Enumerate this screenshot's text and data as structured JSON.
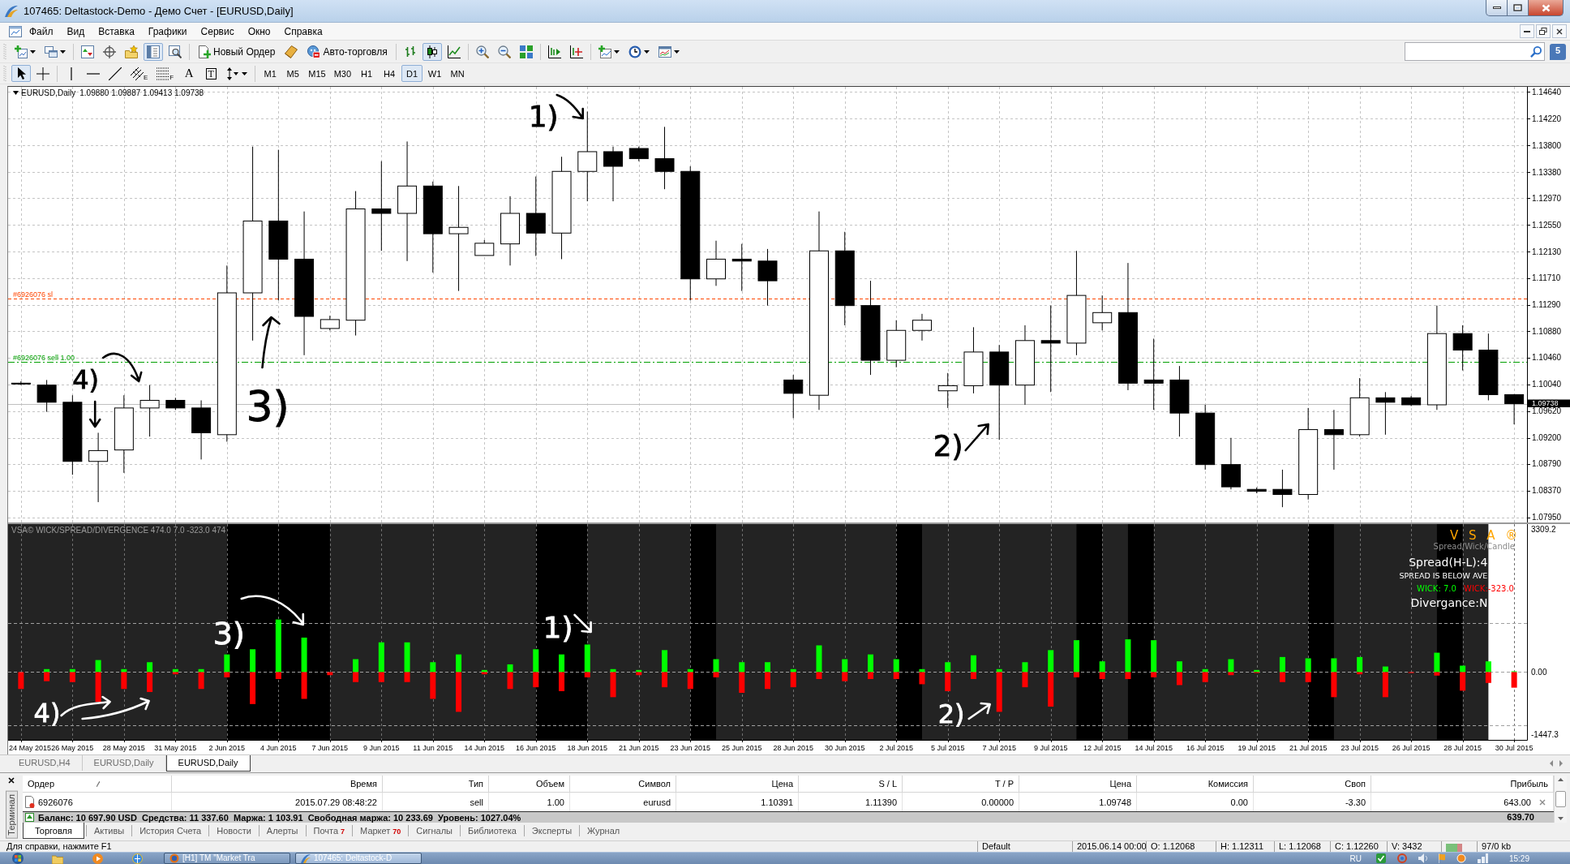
{
  "window": {
    "title": "107465: Deltastock-Demo - Демо Счет - [EURUSD,Daily]"
  },
  "menu": [
    "Файл",
    "Вид",
    "Вставка",
    "Графики",
    "Сервис",
    "Окно",
    "Справка"
  ],
  "toolbar": {
    "new_order": "Новый Ордер",
    "auto_trading": "Авто-торговля",
    "data_window": {
      "selected": true
    },
    "chart_types": [
      {
        "kind": "bars",
        "selected": false
      },
      {
        "kind": "candles",
        "selected": true
      },
      {
        "kind": "line",
        "selected": false
      }
    ],
    "messages": "5"
  },
  "drawing_tools": [
    {
      "kind": "cursor",
      "selected": true
    },
    {
      "kind": "crosshair",
      "selected": false
    },
    {
      "kind": "vertical-line",
      "selected": false
    },
    {
      "kind": "horizontal-line",
      "selected": false
    },
    {
      "kind": "trend-line",
      "selected": false
    },
    {
      "kind": "channel",
      "label": "E",
      "selected": false
    },
    {
      "kind": "fibonacci",
      "label": "F",
      "selected": false
    },
    {
      "kind": "text",
      "label": "A",
      "selected": false
    },
    {
      "kind": "text-label",
      "label": "T",
      "selected": false
    },
    {
      "kind": "arrows",
      "selected": false
    }
  ],
  "periods": [
    {
      "label": "M1",
      "selected": false
    },
    {
      "label": "M5",
      "selected": false
    },
    {
      "label": "M15",
      "selected": false
    },
    {
      "label": "M30",
      "selected": false
    },
    {
      "label": "H1",
      "selected": false
    },
    {
      "label": "H4",
      "selected": false
    },
    {
      "label": "D1",
      "selected": true
    },
    {
      "label": "W1",
      "selected": false
    },
    {
      "label": "MN",
      "selected": false
    }
  ],
  "chart": {
    "chart_data": [
      {
        "type": "candlestick",
        "title": "EURUSD,Daily",
        "subtitle": "1.09880 1.09887 1.09413 1.09738",
        "ohlc": [
          [
            1.1006,
            1.1009,
            1.1003,
            1.1005
          ],
          [
            1.1003,
            1.1011,
            1.0961,
            1.0976
          ],
          [
            1.0976,
            1.0987,
            1.0862,
            1.0883
          ],
          [
            1.0883,
            1.0928,
            1.0819,
            1.09
          ],
          [
            1.0901,
            1.0987,
            1.0865,
            1.0967
          ],
          [
            1.0967,
            1.1003,
            1.0922,
            1.0979
          ],
          [
            1.0979,
            1.0983,
            1.0964,
            1.0967
          ],
          [
            1.0967,
            1.0979,
            1.0886,
            1.0928
          ],
          [
            1.0925,
            1.1191,
            1.0914,
            1.1148
          ],
          [
            1.1148,
            1.1378,
            1.1073,
            1.1261
          ],
          [
            1.1261,
            1.1373,
            1.1136,
            1.1201
          ],
          [
            1.1201,
            1.1276,
            1.105,
            1.1111
          ],
          [
            1.1092,
            1.1112,
            1.1089,
            1.1106
          ],
          [
            1.1105,
            1.1308,
            1.1081,
            1.128
          ],
          [
            1.128,
            1.1355,
            1.1214,
            1.1273
          ],
          [
            1.1273,
            1.1386,
            1.1198,
            1.1316
          ],
          [
            1.1316,
            1.1323,
            1.118,
            1.1241
          ],
          [
            1.1241,
            1.1316,
            1.1151,
            1.1251
          ],
          [
            1.12068,
            1.12311,
            1.12068,
            1.1226
          ],
          [
            1.1225,
            1.13,
            1.1191,
            1.1273
          ],
          [
            1.1273,
            1.1331,
            1.1206,
            1.1242
          ],
          [
            1.1242,
            1.1362,
            1.1201,
            1.1339
          ],
          [
            1.1339,
            1.1433,
            1.1292,
            1.137
          ],
          [
            1.137,
            1.1378,
            1.1292,
            1.1347
          ],
          [
            1.1375,
            1.1378,
            1.1355,
            1.1359
          ],
          [
            1.1359,
            1.1409,
            1.1311,
            1.1339
          ],
          [
            1.1339,
            1.1347,
            1.1136,
            1.117
          ],
          [
            1.117,
            1.123,
            1.1159,
            1.1201
          ],
          [
            1.1201,
            1.1225,
            1.1151,
            1.1198
          ],
          [
            1.1198,
            1.1217,
            1.1128,
            1.1167
          ],
          [
            1.1011,
            1.1019,
            1.0951,
            1.099
          ],
          [
            1.0987,
            1.1276,
            1.0964,
            1.1214
          ],
          [
            1.1214,
            1.1244,
            1.1097,
            1.1128
          ],
          [
            1.1128,
            1.1167,
            1.1019,
            1.1042
          ],
          [
            1.1042,
            1.1105,
            1.1031,
            1.1089
          ],
          [
            1.1089,
            1.1115,
            1.1073,
            1.1105
          ],
          [
            1.0994,
            1.1022,
            1.0967,
            1.1002
          ],
          [
            1.1002,
            1.1094,
            1.099,
            1.1055
          ],
          [
            1.1055,
            1.1066,
            1.0917,
            1.1003
          ],
          [
            1.1003,
            1.1097,
            1.0972,
            1.1073
          ],
          [
            1.1073,
            1.1128,
            1.0992,
            1.1069
          ],
          [
            1.1069,
            1.1214,
            1.105,
            1.1144
          ],
          [
            1.1101,
            1.1144,
            1.1089,
            1.1117
          ],
          [
            1.1117,
            1.1195,
            1.0995,
            1.1006
          ],
          [
            1.1011,
            1.1076,
            1.0964,
            1.1006
          ],
          [
            1.1011,
            1.1033,
            1.0922,
            1.0959
          ],
          [
            1.0959,
            1.0972,
            1.087,
            1.0878
          ],
          [
            1.0878,
            1.092,
            1.0839,
            1.0843
          ],
          [
            1.0839,
            1.0842,
            1.0833,
            1.0836
          ],
          [
            1.0839,
            1.087,
            1.0811,
            1.0831
          ],
          [
            1.0831,
            1.0967,
            1.0823,
            1.0933
          ],
          [
            1.0933,
            1.0964,
            1.087,
            1.0925
          ],
          [
            1.0925,
            1.1014,
            1.0922,
            1.0983
          ],
          [
            1.0983,
            1.0992,
            1.0925,
            1.0976
          ],
          [
            1.0983,
            1.0986,
            1.097,
            1.0972
          ],
          [
            1.0972,
            1.1128,
            1.0964,
            1.1084
          ],
          [
            1.1084,
            1.1097,
            1.1026,
            1.1058
          ],
          [
            1.1058,
            1.1084,
            1.0979,
            1.0988
          ],
          [
            1.0988,
            1.09887,
            1.09413,
            1.09738
          ]
        ],
        "ylim": [
          1.0787,
          1.1472
        ],
        "yticks": [
          {
            "value": 1.1464,
            "label": "1.14640"
          },
          {
            "value": 1.1422,
            "label": "1.14220"
          },
          {
            "value": 1.138,
            "label": "1.13800"
          },
          {
            "value": 1.1338,
            "label": "1.13380"
          },
          {
            "value": 1.1297,
            "label": "1.12970"
          },
          {
            "value": 1.1255,
            "label": "1.12550"
          },
          {
            "value": 1.1213,
            "label": "1.12130"
          },
          {
            "value": 1.1171,
            "label": "1.11710"
          },
          {
            "value": 1.1129,
            "label": "1.11290"
          },
          {
            "value": 1.1088,
            "label": "1.10880"
          },
          {
            "value": 1.1046,
            "label": "1.10460"
          },
          {
            "value": 1.1004,
            "label": "1.10040"
          },
          {
            "value": 1.0962,
            "label": "1.09620"
          },
          {
            "value": 1.092,
            "label": "1.09200"
          },
          {
            "value": 1.0879,
            "label": "1.08790"
          },
          {
            "value": 1.0837,
            "label": "1.08370"
          },
          {
            "value": 1.0795,
            "label": "1.07950"
          }
        ],
        "tick_labels": "y",
        "grid": true,
        "ref_lines": [
          {
            "axis": "y",
            "value": 1.1139,
            "label": "#6926076 sl",
            "color": "#ff4500",
            "line_style": "dashed"
          },
          {
            "axis": "y",
            "value": 1.10391,
            "label": "#6926076 sell 1.00",
            "color": "#00a000",
            "line_style": "dashdot"
          },
          {
            "axis": "y",
            "value": 1.09738,
            "label": "1.09738",
            "color": "#c0c0c0",
            "line_style": "solid"
          }
        ],
        "annotations": [
          "1)",
          "4)",
          "3)",
          "2)"
        ]
      },
      {
        "type": "bar",
        "title": "VSA© WICK/SPREAD/DIVERGENCE 474.0 7.0 -323.0 474",
        "categories": [
          "24 May 2015",
          null,
          "26 May 2015",
          null,
          "28 May 2015",
          null,
          "31 May 2015",
          null,
          "2 Jun 2015",
          null,
          "4 Jun 2015",
          null,
          "7 Jun 2015",
          null,
          "9 Jun 2015",
          null,
          "11 Jun 2015",
          null,
          "14 Jun 2015",
          null,
          "16 Jun 2015",
          null,
          "18 Jun 2015",
          null,
          "21 Jun 2015",
          null,
          "23 Jun 2015",
          null,
          "25 Jun 2015",
          null,
          "28 Jun 2015",
          null,
          "30 Jun 2015",
          null,
          "2 Jul 2015",
          null,
          "5 Jul 2015",
          null,
          "7 Jul 2015",
          null,
          "9 Jul 2015",
          null,
          "12 Jul 2015",
          null,
          "14 Jul 2015",
          null,
          "16 Jul 2015",
          null,
          "19 Jul 2015",
          null,
          "21 Jul 2015",
          null,
          "23 Jul 2015",
          null,
          "26 Jul 2015",
          null,
          "28 Jul 2015",
          null,
          "30 Jul 2015"
        ],
        "stacked": true,
        "series": [
          {
            "color": "#00ff00",
            "values": [
              null,
              70,
              70,
              280,
              70,
              230,
              70,
              70,
              410,
              530,
              1220,
              800,
              null,
              300,
              690,
              690,
              230,
              410,
              50,
              180,
              530,
              410,
              640,
              70,
              50,
              510,
              70,
              300,
              230,
              230,
              70,
              620,
              300,
              410,
              300,
              70,
              230,
              390,
              70,
              230,
              510,
              740,
              250,
              760,
              740,
              250,
              70,
              300,
              50,
              350,
              320,
              320,
              350,
              130,
              null,
              450,
              150,
              250,
              20
            ]
          },
          {
            "color": "#ff0000",
            "values": [
              -390,
              -210,
              -230,
              -690,
              -390,
              -460,
              -50,
              -390,
              -120,
              -740,
              -160,
              -620,
              -70,
              -230,
              -230,
              -230,
              -620,
              -920,
              -50,
              -390,
              -350,
              -440,
              -120,
              -580,
              -70,
              -350,
              -390,
              -120,
              -480,
              -390,
              -350,
              -160,
              -210,
              -160,
              -160,
              -280,
              -440,
              -160,
              -920,
              -350,
              -800,
              -120,
              -160,
              -160,
              -120,
              -300,
              -230,
              -70,
              -20,
              -230,
              -230,
              -580,
              -50,
              -580,
              -20,
              -80,
              -430,
              -250,
              -360
            ]
          }
        ],
        "ylim": [
          -1570,
          3431
        ],
        "yticks": [
          {
            "value": 3309.2,
            "label": "3309.2"
          },
          {
            "value": 0,
            "label": "0.00"
          },
          {
            "value": -1447.3,
            "label": "-1447.3"
          }
        ],
        "grid": true,
        "bands": [
          {
            "axis": "x",
            "from": "2 Jun 2015",
            "to": "7 Jun 2015",
            "color": "#000000"
          },
          {
            "axis": "x",
            "from": "16 Jun 2015",
            "to": "18 Jun 2015",
            "color": "#000000"
          }
        ],
        "ref_lines": [
          {
            "axis": "y",
            "value": 1130,
            "color": "#a0a0a0",
            "line_style": "dashed"
          },
          {
            "axis": "y",
            "value": 0,
            "color": "#a0a0a0",
            "line_style": "dashed"
          },
          {
            "axis": "y",
            "value": -1230,
            "color": "#a0a0a0",
            "line_style": "dashed"
          }
        ],
        "annotations": [
          "3)",
          "1)",
          "4)",
          "2)"
        ]
      }
    ],
    "info": {
      "logo": "V S A ®",
      "caption": "Spread/Wick/Candle",
      "spread": "Spread(H-L):4",
      "spread_note": "SPREAD IS BELOW AVE",
      "wick_up": "WICK: 7.0",
      "wick_down": "WICK:-323.0",
      "divergence": "Divergance:N"
    }
  },
  "chart_tabs": [
    {
      "label": "EURUSD,H4",
      "selected": false
    },
    {
      "label": "EURUSD,Daily",
      "selected": false
    },
    {
      "label": "EURUSD,Daily",
      "selected": true
    }
  ],
  "terminal": {
    "label": "Терминал",
    "columns": [
      "Ордер",
      "Время",
      "Тип",
      "Объем",
      "Символ",
      "Цена",
      "S / L",
      "T / P",
      "Цена",
      "Комиссия",
      "Своп",
      "Прибыль"
    ],
    "rows": [
      {
        "cells": [
          "6926076",
          "2015.07.29 08:48:22",
          "sell",
          "1.00",
          "eurusd",
          "1.10391",
          "1.11390",
          "0.00000",
          "1.09748",
          "0.00",
          "-3.30",
          "643.00"
        ]
      }
    ],
    "summary": {
      "text": "Баланс: 10 697.90 USD  Средства: 11 337.60  Маржа: 1 103.91  Свободная маржа: 10 233.69  Уровень: 1027.04%",
      "profit": "639.70"
    },
    "tabs": [
      {
        "label": "Торговля",
        "selected": true
      },
      {
        "label": "Активы",
        "selected": false
      },
      {
        "label": "История Счета",
        "selected": false
      },
      {
        "label": "Новости",
        "selected": false
      },
      {
        "label": "Алерты",
        "selected": false
      },
      {
        "label": "Почта",
        "badge": "7",
        "selected": false
      },
      {
        "label": "Маркет",
        "badge": "70",
        "selected": false
      },
      {
        "label": "Сигналы",
        "selected": false
      },
      {
        "label": "Библиотека",
        "selected": false
      },
      {
        "label": "Эксперты",
        "selected": false
      },
      {
        "label": "Журнал",
        "selected": false
      }
    ]
  },
  "status_bar": {
    "help": "Для справки, нажмите F1",
    "profile": "Default",
    "time": "2015.06.14 00:00",
    "open": "O: 1.12068",
    "high": "H: 1.12311",
    "low": "L: 1.12068",
    "close": "C: 1.12260",
    "volume": "V: 3432",
    "traffic": "97/0 kb"
  },
  "taskbar": {
    "tasks": [
      {
        "label": "[H1] TM \"Market Tra",
        "selected": false
      },
      {
        "label": "107465: Deltastock-D",
        "selected": true
      }
    ],
    "language": "RU",
    "clock": "15:29"
  }
}
